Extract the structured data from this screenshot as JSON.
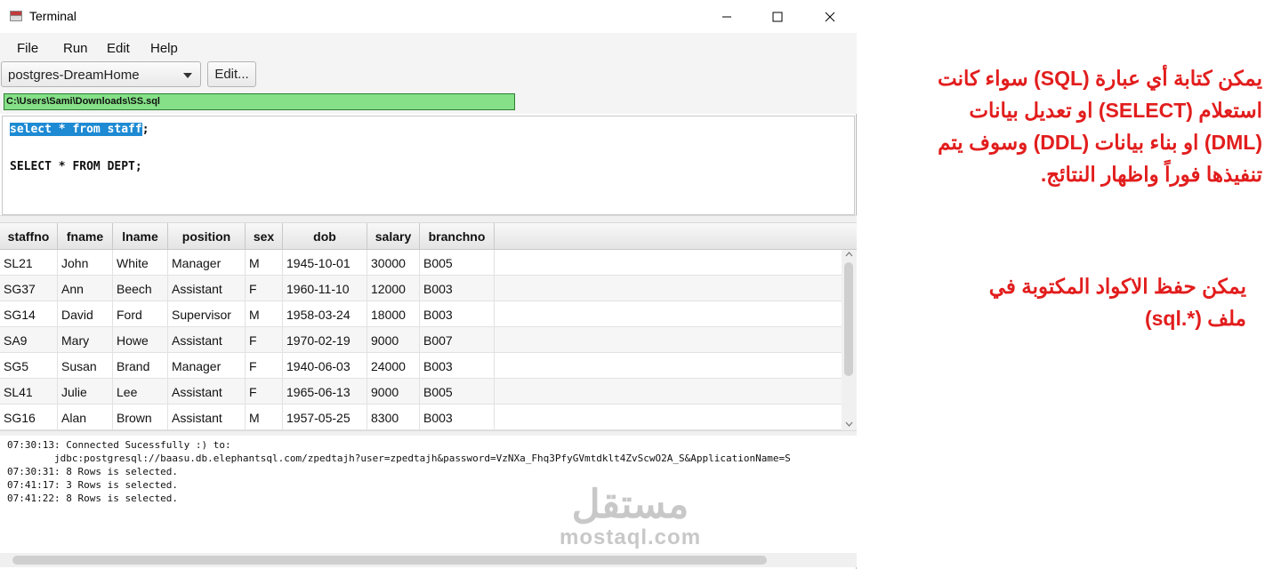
{
  "window": {
    "title": "Terminal"
  },
  "menu": [
    "File",
    "Run",
    "Edit",
    "Help"
  ],
  "toolbar": {
    "connection": "postgres-DreamHome",
    "edit_label": "Edit..."
  },
  "file_path": "C:\\Users\\Sami\\Downloads\\SS.sql",
  "editor": {
    "line1_selected": "select * from staff",
    "line1_rest": ";",
    "line2": "SELECT * FROM DEPT;"
  },
  "table": {
    "columns": [
      "staffno",
      "fname",
      "lname",
      "position",
      "sex",
      "dob",
      "salary",
      "branchno"
    ],
    "rows": [
      [
        "SL21",
        "John",
        "White",
        "Manager",
        "M",
        "1945-10-01",
        "30000",
        "B005"
      ],
      [
        "SG37",
        "Ann",
        "Beech",
        "Assistant",
        "F",
        "1960-11-10",
        "12000",
        "B003"
      ],
      [
        "SG14",
        "David",
        "Ford",
        "Supervisor",
        "M",
        "1958-03-24",
        "18000",
        "B003"
      ],
      [
        "SA9",
        "Mary",
        "Howe",
        "Assistant",
        "F",
        "1970-02-19",
        "9000",
        "B007"
      ],
      [
        "SG5",
        "Susan",
        "Brand",
        "Manager",
        "F",
        "1940-06-03",
        "24000",
        "B003"
      ],
      [
        "SL41",
        "Julie",
        "Lee",
        "Assistant",
        "F",
        "1965-06-13",
        "9000",
        "B005"
      ],
      [
        "SG16",
        "Alan",
        "Brown",
        "Assistant",
        "M",
        "1957-05-25",
        "8300",
        "B003"
      ]
    ]
  },
  "log": [
    "07:30:13: Connected Sucessfully :) to:",
    "        jdbc:postgresql://baasu.db.elephantsql.com/zpedtajh?user=zpedtajh&password=VzNXa_Fhq3PfyGVmtdklt4ZvScwO2A_S&ApplicationName=S",
    "07:30:31: 8 Rows is selected.",
    "07:41:17: 3 Rows is selected.",
    "07:41:22: 8 Rows is selected."
  ],
  "watermark": {
    "arabic": "مستقل",
    "latin": "mostaql.com"
  },
  "notes": {
    "note1": [
      "يمكن كتابة أي عبارة (SQL) سواء كانت",
      "استعلام (SELECT) او تعديل بيانات",
      "(DML) او بناء بيانات (DDL) وسوف يتم",
      "تنفيذها فوراً واظهار النتائج."
    ],
    "note2": [
      "يمكن حفظ الاكواد المكتوبة في",
      "ملف (*.sql)"
    ]
  },
  "colors": {
    "accent_red": "#e21d1d",
    "path_green": "#85e087",
    "selection_blue": "#1d8ad3"
  }
}
